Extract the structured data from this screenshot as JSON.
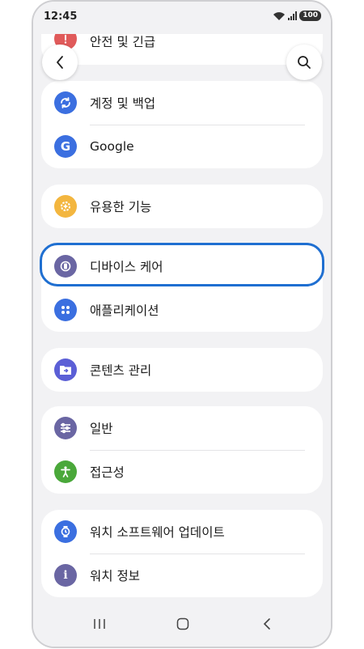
{
  "status": {
    "time": "12:45",
    "battery": "100"
  },
  "menu": {
    "safety": "안전 및 긴급",
    "account_backup": "계정 및 백업",
    "google": "Google",
    "useful_features": "유용한 기능",
    "device_care": "디바이스 케어",
    "apps": "애플리케이션",
    "content_management": "콘텐츠 관리",
    "general": "일반",
    "accessibility": "접근성",
    "watch_software_update": "워치 소프트웨어 업데이트",
    "watch_info": "워치 정보"
  },
  "colors": {
    "accent_highlight": "#1f6fd1",
    "safety_icon": "#e05a5a",
    "account_icon": "#3b6fe0",
    "google_icon": "#3b6fe0",
    "useful_icon": "#f3b63f",
    "device_care_icon": "#6a66a3",
    "apps_icon": "#3b6fe0",
    "content_icon": "#5b5fd6",
    "general_icon": "#6a66a3",
    "accessibility_icon": "#4aa83a",
    "watch_update_icon": "#3b6fe0",
    "watch_info_icon": "#6a66a3"
  },
  "icons": {
    "back": "chevron-left-icon",
    "search": "search-icon",
    "account_backup": "sync-icon",
    "google": "google-g-icon",
    "useful_features": "gear-plus-icon",
    "device_care": "device-care-icon",
    "apps": "apps-grid-icon",
    "content_management": "folder-share-icon",
    "general": "sliders-icon",
    "accessibility": "person-accessibility-icon",
    "watch_software_update": "watch-update-icon",
    "watch_info": "info-icon"
  }
}
